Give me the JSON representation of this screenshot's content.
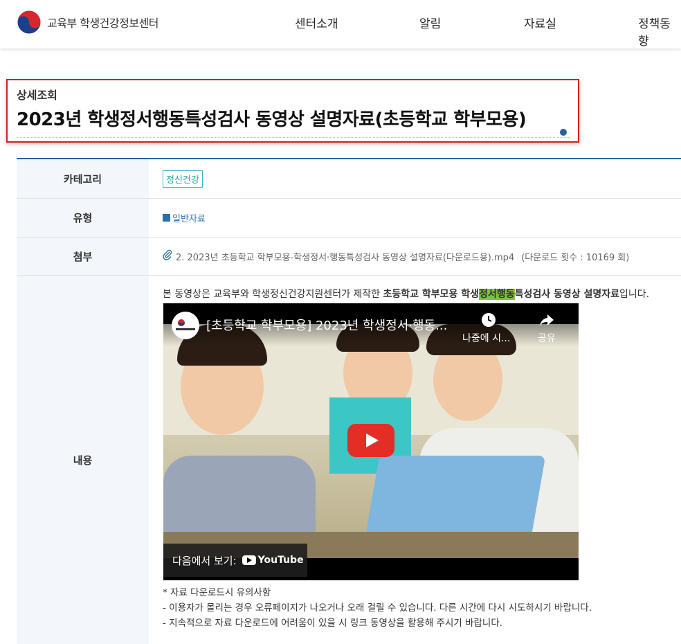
{
  "header": {
    "logo_text": "교육부 학생건강정보센터",
    "nav": [
      "센터소개",
      "알림",
      "자료실",
      "정책동향"
    ]
  },
  "page": {
    "crumb": "상세조회",
    "title": "2023년 학생정서행동특성검사 동영상 설명자료(초등학교 학부모용)"
  },
  "table": {
    "category_label": "카테고리",
    "category_value": "정신건강",
    "type_label": "유형",
    "type_value": "일반자료",
    "attach_label": "첨부",
    "attach_file": "2. 2023년 초등학교 학부모용-학생정서·행동특성검사 동영상 설명자료(다운로드용).mp4",
    "attach_count": "(다운로드 횟수 : 10169 회)",
    "content_label": "내용"
  },
  "content": {
    "desc_pre": "본 동영상은 교육부와 학생정신건강지원센터가 제작한 ",
    "desc_bold1": "초등학교 학부모용 학생",
    "desc_hl": "정서행동",
    "desc_bold2": "특성검사 동영상 설명자료",
    "desc_post": "입니다.",
    "notes": [
      "* 자료 다운로드시 유의사항",
      "- 이용자가 몰리는 경우 오류페이지가 나오거나 오래 걸릴 수 있습니다. 다른 시간에 다시 시도하시기 바랍니다.",
      "- 지속적으로 자료 다운로드에 어려움이 있을 시 링크 동영상을 활용해 주시기 바랍니다."
    ]
  },
  "video": {
    "title": "[초등학교 학부모용] 2023년 학생정서·행동...",
    "later_label": "나중에 시...",
    "share_label": "공유",
    "watch_on": "다음에서 보기:",
    "youtube": "YouTube"
  }
}
